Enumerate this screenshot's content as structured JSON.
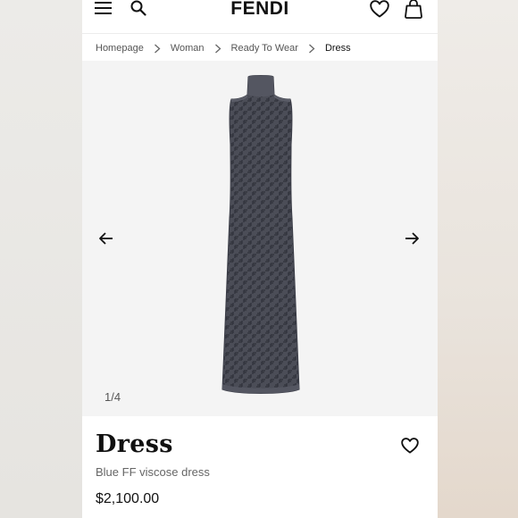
{
  "header": {
    "brand": "FENDI",
    "icons": {
      "menu": "hamburger-menu-icon",
      "search": "search-icon",
      "wishlist": "heart-outline-icon",
      "bag": "shopping-bag-icon"
    }
  },
  "breadcrumb": {
    "items": [
      {
        "label": "Homepage"
      },
      {
        "label": "Woman"
      },
      {
        "label": "Ready To Wear"
      },
      {
        "label": "Dress"
      }
    ]
  },
  "gallery": {
    "counter": "1/4",
    "current_index": 1,
    "total": 4,
    "icons": {
      "prev": "arrow-left-icon",
      "next": "arrow-right-icon"
    }
  },
  "product": {
    "title": "Dress",
    "subtitle": "Blue FF viscose dress",
    "price": "$2,100.00"
  },
  "colors": {
    "page_bg": "#ffffff",
    "gallery_bg": "#f4f4f4",
    "dress_base": "#4b4d57",
    "dress_pattern": "#2f313a",
    "text_primary": "#111111",
    "text_secondary": "#666666"
  }
}
